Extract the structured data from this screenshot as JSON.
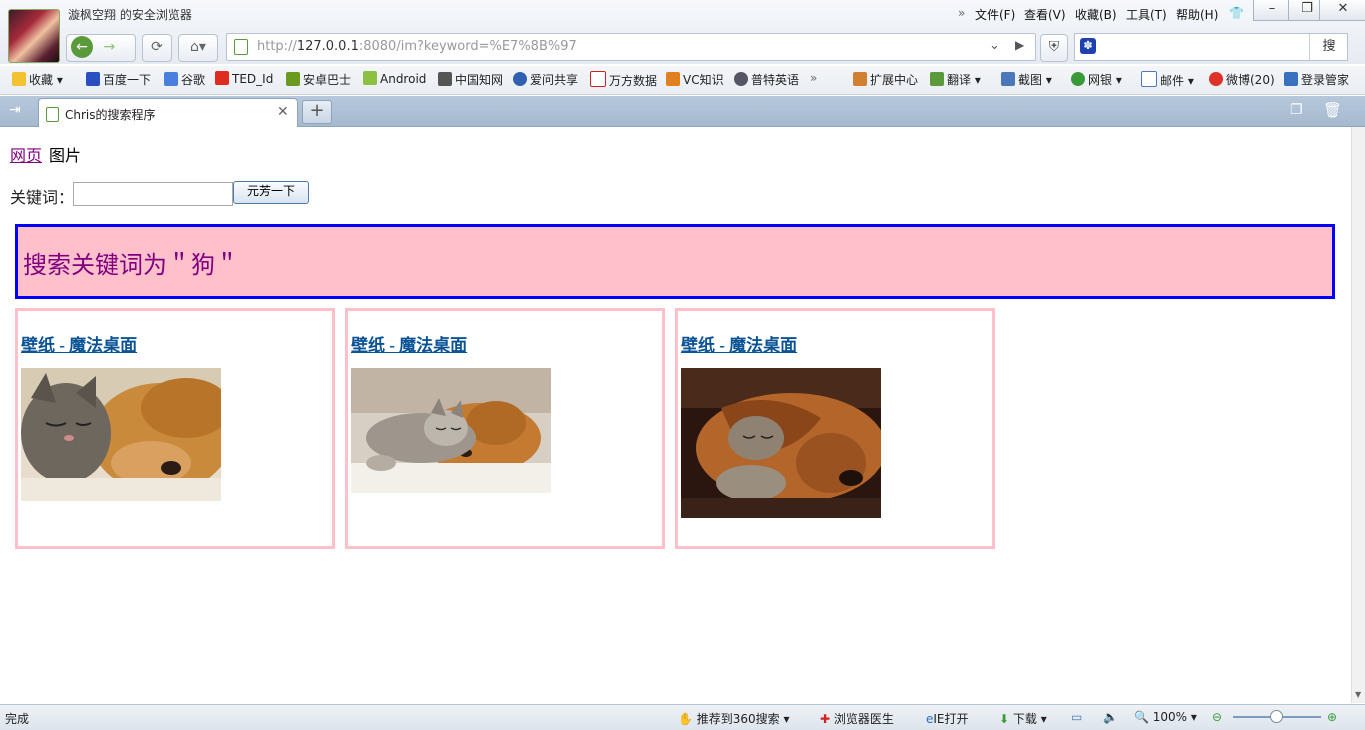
{
  "browser": {
    "title": "漩枫空翔 的安全浏览器",
    "menus": [
      "文件(F)",
      "查看(V)",
      "收藏(B)",
      "工具(T)",
      "帮助(H)"
    ],
    "address_prefix": "http://",
    "address_host": "127.0.0.1",
    "address_rest": ":8080/im?keyword=%E7%8B%97",
    "search_button": "搜",
    "bookmarks": [
      "收藏",
      "百度一下",
      "谷歌",
      "TED_Id",
      "安卓巴士",
      "Android",
      "中国知网",
      "爱问共享",
      "万方数据",
      "VC知识",
      "普特英语"
    ],
    "bookmarks_right": [
      "扩展中心",
      "翻译",
      "截图",
      "网银",
      "邮件",
      "微博(20)",
      "登录管家"
    ],
    "tab_label": "Chris的搜索程序"
  },
  "page": {
    "nav_web": "网页",
    "nav_images": "图片",
    "keyword_label": "关键词：",
    "keyword_value": "",
    "submit_label": "元芳一下",
    "banner": "搜索关键词为＂狗＂",
    "results": [
      {
        "title": "壁纸 - 魔法桌面",
        "image": "cat and golden dog sleeping"
      },
      {
        "title": "壁纸 - 魔法桌面",
        "image": "kitten and puppy sleeping on blanket"
      },
      {
        "title": "壁纸 - 魔法桌面",
        "image": "cat under bloodhound ear"
      }
    ]
  },
  "status": {
    "left": "完成",
    "items": [
      "推荐到360搜索",
      "浏览器医生",
      "IE打开",
      "下载"
    ],
    "zoom": "100%"
  }
}
